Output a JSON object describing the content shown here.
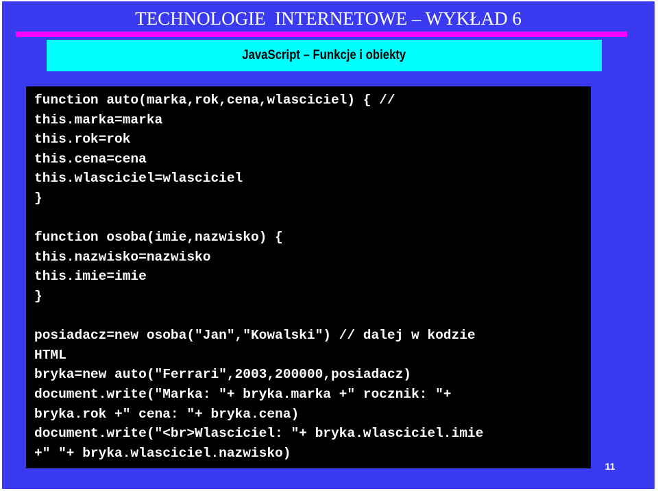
{
  "slide": {
    "title": "TECHNOLOGIE  INTERNETOWE – WYKŁAD 6",
    "subtitle": "JavaScript – Funkcje i obiekty",
    "colors": {
      "background": "#3a3af0",
      "accent_bar": "#ff00ff",
      "subtitle_box": "#00ffff",
      "code_background": "#000000",
      "code_text": "#ffffff"
    },
    "code_lines": [
      "function auto(marka,rok,cena,wlasciciel) { //",
      "this.marka=marka",
      "this.rok=rok",
      "this.cena=cena",
      "this.wlasciciel=wlasciciel",
      "}",
      "",
      "function osoba(imie,nazwisko) {",
      "this.nazwisko=nazwisko",
      "this.imie=imie",
      "}",
      "",
      "posiadacz=new osoba(\"Jan\",\"Kowalski\") // dalej w kodzie",
      "HTML",
      "bryka=new auto(\"Ferrari\",2003,200000,posiadacz)",
      "document.write(\"Marka: \"+ bryka.marka +\" rocznik: \"+",
      "bryka.rok +\" cena: \"+ bryka.cena)",
      "document.write(\"<br>Wlasciciel: \"+ bryka.wlasciciel.imie",
      "+\" \"+ bryka.wlasciciel.nazwisko)"
    ],
    "page_number": "11"
  }
}
